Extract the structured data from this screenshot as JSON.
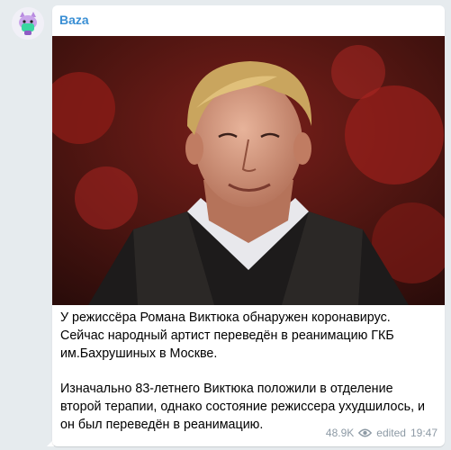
{
  "channel": {
    "name": "Baza",
    "avatar_icon": "baza-cat-logo"
  },
  "post": {
    "photo_description_icon": "portrait-photo",
    "paragraphs": [
      "У режиссёра Романа Виктюка обнаружен коронавирус. Сейчас народный артист переведён в реанимацию ГКБ им.Бахрушиных в Москве.",
      "Изначально 83-летнего Виктюка положили в отделение второй терапии, однако состояние режиссера ухудшилось, и он был переведён в реанимацию."
    ],
    "views": "48.9K",
    "edited_label": "edited",
    "time": "19:47"
  },
  "colors": {
    "background": "#e6ebee",
    "bubble": "#ffffff",
    "channel_name": "#3a8fd4",
    "meta": "#8d9aa5"
  }
}
